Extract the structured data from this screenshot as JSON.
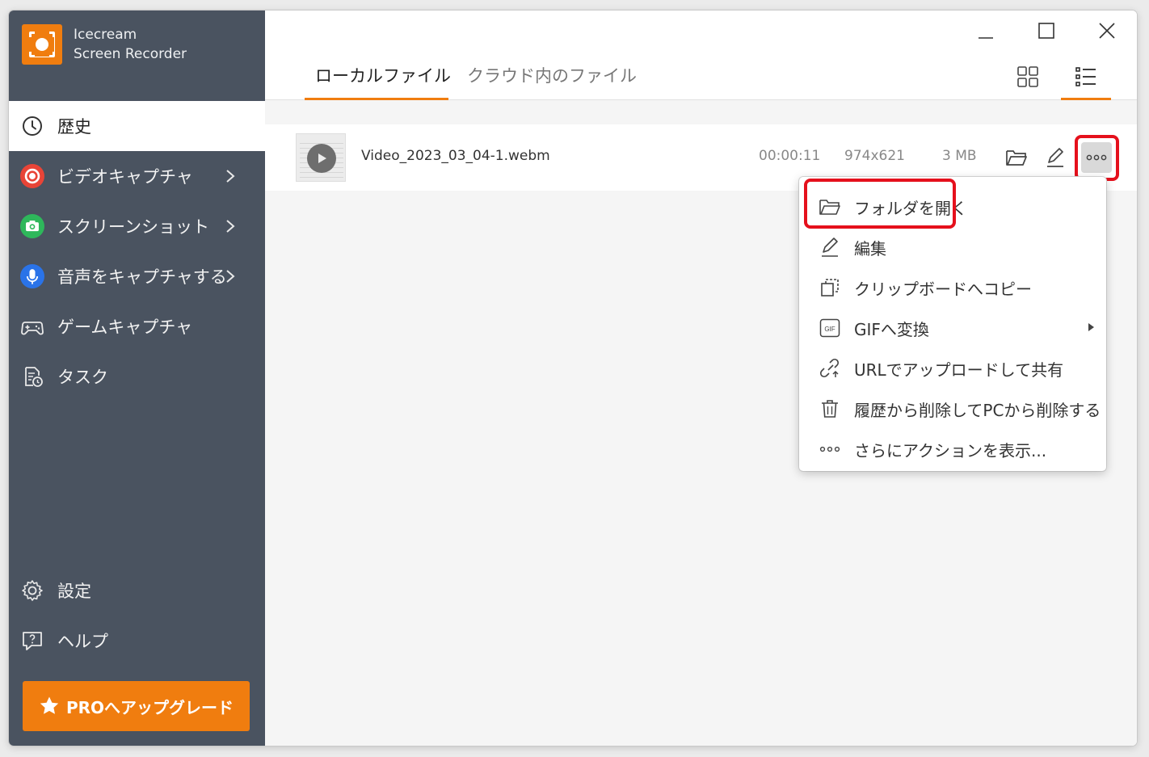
{
  "app": {
    "name_line1": "Icecream",
    "name_line2": "Screen Recorder"
  },
  "sidebar": {
    "items": [
      {
        "label": "歴史"
      },
      {
        "label": "ビデオキャプチャ"
      },
      {
        "label": "スクリーンショット"
      },
      {
        "label": "音声をキャプチャする"
      },
      {
        "label": "ゲームキャプチャ"
      },
      {
        "label": "タスク"
      }
    ],
    "bottom": [
      {
        "label": "設定"
      },
      {
        "label": "ヘルプ"
      }
    ],
    "upgrade_label": "PROへアップグレード"
  },
  "tabs": [
    {
      "label": "ローカルファイル"
    },
    {
      "label": "クラウド内のファイル"
    }
  ],
  "file": {
    "name": "Video_2023_03_04-1.webm",
    "duration": "00:00:11",
    "resolution": "974x621",
    "size": "3 MB"
  },
  "menu": {
    "items": [
      {
        "label": "フォルダを開く"
      },
      {
        "label": "編集"
      },
      {
        "label": "クリップボードへコピー"
      },
      {
        "label": "GIFへ変換"
      },
      {
        "label": "URLでアップロードして共有"
      },
      {
        "label": "履歴から削除してPCから削除する"
      },
      {
        "label": "さらにアクションを表示..."
      }
    ],
    "gif_badge": "GIF"
  },
  "colors": {
    "accent": "#f07d0f",
    "sidebar": "#4a5360",
    "highlight": "#e5101c"
  }
}
